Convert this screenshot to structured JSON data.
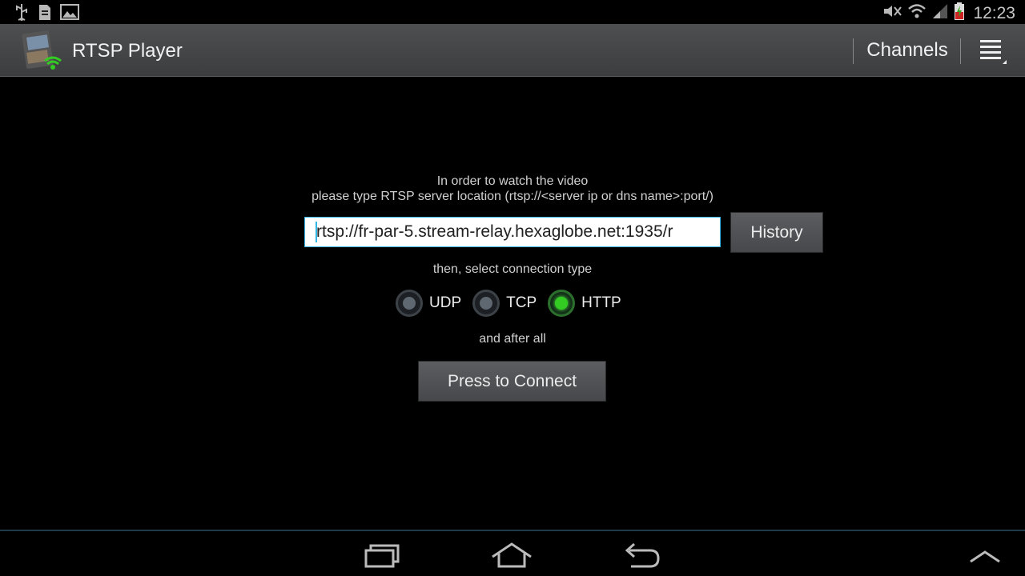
{
  "status_bar": {
    "left_icons": [
      "usb-icon",
      "sd-card-icon",
      "image-icon"
    ],
    "right_icons": [
      "mute-icon",
      "wifi-icon",
      "signal-icon",
      "battery-charging-icon"
    ],
    "time": "12:23"
  },
  "action_bar": {
    "title": "RTSP Player",
    "channels_label": "Channels",
    "overflow_icon": "overflow-menu-icon"
  },
  "main": {
    "instruction_line1": "In order to watch the video",
    "instruction_line2": "please type RTSP server location (rtsp://<server ip or dns name>:port/)",
    "url_value": "rtsp://fr-par-5.stream-relay.hexaglobe.net:1935/r",
    "history_label": "History",
    "select_text": "then, select connection type",
    "connection_types": [
      {
        "label": "UDP",
        "checked": false
      },
      {
        "label": "TCP",
        "checked": false
      },
      {
        "label": "HTTP",
        "checked": true
      }
    ],
    "after_text": "and after all",
    "connect_label": "Press to Connect"
  },
  "nav_bar": {
    "buttons": [
      "recent-apps-icon",
      "home-icon",
      "back-icon",
      "expand-up-icon"
    ]
  },
  "colors": {
    "accent": "#33b5e5",
    "radio_checked": "#33cc22"
  }
}
